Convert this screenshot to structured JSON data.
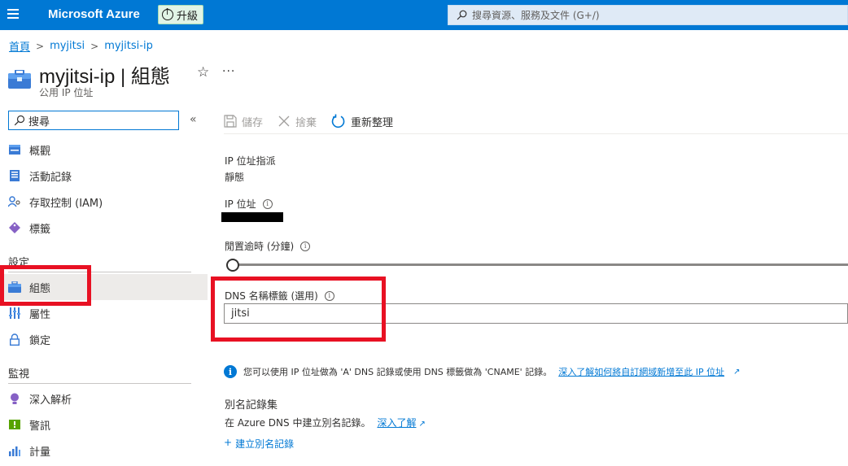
{
  "topbar": {
    "brand": "Microsoft Azure",
    "upgrade_label": "升級",
    "search_placeholder": "搜尋資源、服務及文件 (G+/)"
  },
  "breadcrumb": [
    "首頁",
    "myjitsi",
    "myjitsi-ip"
  ],
  "header": {
    "title": "myjitsi-ip | 組態",
    "subtitle": "公用 IP 位址",
    "star_icon": "☆",
    "more": "···"
  },
  "nav": {
    "search_placeholder": "搜尋",
    "collapse": "«",
    "items_top": [
      {
        "label": "概觀",
        "icon": "overview-icon"
      },
      {
        "label": "活動記錄",
        "icon": "activity-log-icon"
      },
      {
        "label": "存取控制 (IAM)",
        "icon": "iam-icon"
      },
      {
        "label": "標籤",
        "icon": "tag-icon"
      }
    ],
    "section_settings": "設定",
    "items_settings": [
      {
        "label": "組態",
        "icon": "configuration-icon",
        "active": true
      },
      {
        "label": "屬性",
        "icon": "properties-icon"
      },
      {
        "label": "鎖定",
        "icon": "lock-icon"
      }
    ],
    "section_monitoring": "監視",
    "items_monitoring": [
      {
        "label": "深入解析",
        "icon": "insights-icon"
      },
      {
        "label": "警訊",
        "icon": "alerts-icon"
      },
      {
        "label": "計量",
        "icon": "metrics-icon"
      }
    ]
  },
  "toolbar": {
    "save": "儲存",
    "discard": "捨棄",
    "refresh": "重新整理"
  },
  "form": {
    "assignment_label": "IP 位址指派",
    "assignment_value": "靜態",
    "ip_label": "IP 位址",
    "idle_timeout_label": "閒置逾時 (分鐘)",
    "idle_timeout_value": 4,
    "idle_timeout_min": 4,
    "idle_timeout_max": 30,
    "dns_label": "DNS 名稱標籤 (選用)",
    "dns_value": "jitsi"
  },
  "info": {
    "text": "您可以使用 IP 位址做為 'A' DNS 記錄或使用 DNS 標籤做為 'CNAME' 記錄。",
    "link": "深入了解如何將自訂網域新增至此 IP 位址"
  },
  "alias": {
    "title": "別名記錄集",
    "text": "在 Azure DNS 中建立別名記錄。",
    "learn_more": "深入了解",
    "create": "建立別名記錄"
  },
  "colors": {
    "azure_blue": "#0078d4",
    "highlight_red": "#e81123"
  }
}
